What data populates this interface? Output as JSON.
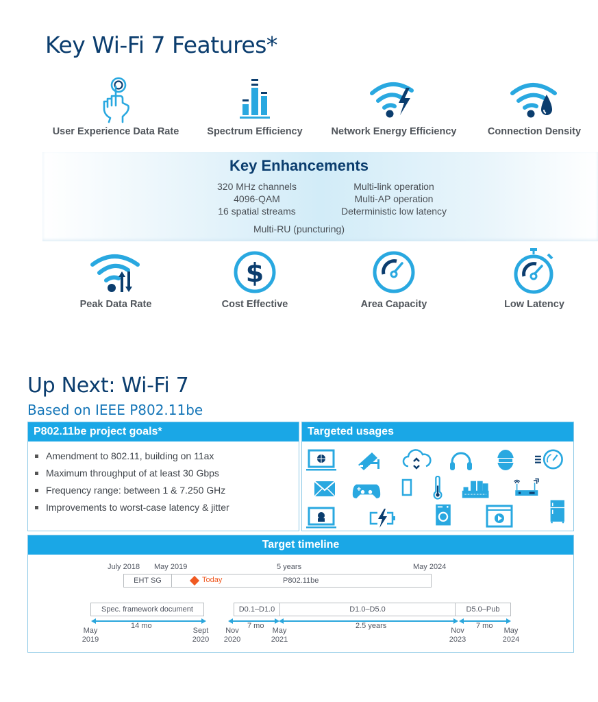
{
  "top": {
    "title": "Key Wi-Fi 7 Features*",
    "features_top": [
      {
        "label": "User Experience Data Rate",
        "icon": "touch-hand-icon"
      },
      {
        "label": "Spectrum Efficiency",
        "icon": "bar-chart-icon"
      },
      {
        "label": "Network Energy Efficiency",
        "icon": "wifi-lightning-icon"
      },
      {
        "label": "Connection Density",
        "icon": "wifi-drop-icon"
      }
    ],
    "enhancements": {
      "title": "Key Enhancements",
      "left": [
        "320 MHz channels",
        "4096-QAM",
        "16 spatial streams"
      ],
      "right": [
        "Multi-link operation",
        "Multi-AP operation",
        "Deterministic low latency"
      ],
      "bottom": "Multi-RU (puncturing)"
    },
    "features_bottom": [
      {
        "label": "Peak Data Rate",
        "icon": "wifi-arrows-icon"
      },
      {
        "label": "Cost Effective",
        "icon": "dollar-icon"
      },
      {
        "label": "Area Capacity",
        "icon": "gauge-icon"
      },
      {
        "label": "Low Latency",
        "icon": "stopwatch-icon"
      }
    ]
  },
  "bottom": {
    "title": "Up Next: Wi-Fi 7",
    "subtitle": "Based on IEEE P802.11be",
    "goals": {
      "header": "P802.11be project goals*",
      "items": [
        "Amendment to 802.11, building on 11ax",
        "Maximum throughput of at least 30 Gbps",
        "Frequency range: between 1 & 7.250 GHz",
        "Improvements to worst-case latency & jitter"
      ]
    },
    "usages": {
      "header": "Targeted usages",
      "icons": [
        "laptop-globe-icon",
        "security-camera-icon",
        "cloud-sync-icon",
        "headphones-icon",
        "vr-headset-icon",
        "speed-gauge-icon",
        "envelope-icon",
        "gamepad-icon",
        "smartphone-icon",
        "thermometer-icon",
        "factory-icon",
        "router-icon",
        "laptop-video-call-icon",
        "battery-charging-icon",
        "washing-machine-icon",
        "video-player-icon",
        "refrigerator-icon"
      ]
    },
    "timeline": {
      "header": "Target timeline",
      "top_labels": {
        "jul2018": "July 2018",
        "may2019": "May 2019",
        "span": "5 years",
        "may2024": "May 2024"
      },
      "top_bar": {
        "eht": "EHT SG",
        "today": "Today",
        "project": "P802.11be"
      },
      "phases": [
        {
          "label": "Spec. framework document",
          "duration": "14 mo",
          "start": [
            "May",
            "2019"
          ],
          "end": [
            "Sept",
            "2020"
          ]
        },
        {
          "label": "D0.1–D1.0",
          "duration": "7 mo",
          "start": [
            "Nov",
            "2020"
          ],
          "end": [
            "May",
            "2021"
          ]
        },
        {
          "label": "D1.0–D5.0",
          "duration": "2.5 years",
          "end": [
            "Nov",
            "2023"
          ]
        },
        {
          "label": "D5.0–Pub",
          "duration": "7 mo",
          "end": [
            "May",
            "2024"
          ]
        }
      ],
      "today_color": "#f05a22"
    }
  },
  "colors": {
    "navy": "#0b3d6e",
    "accent_blue": "#1aa7e6",
    "light_blue": "#2aa6dc",
    "subtitle_blue": "#1576b8"
  }
}
